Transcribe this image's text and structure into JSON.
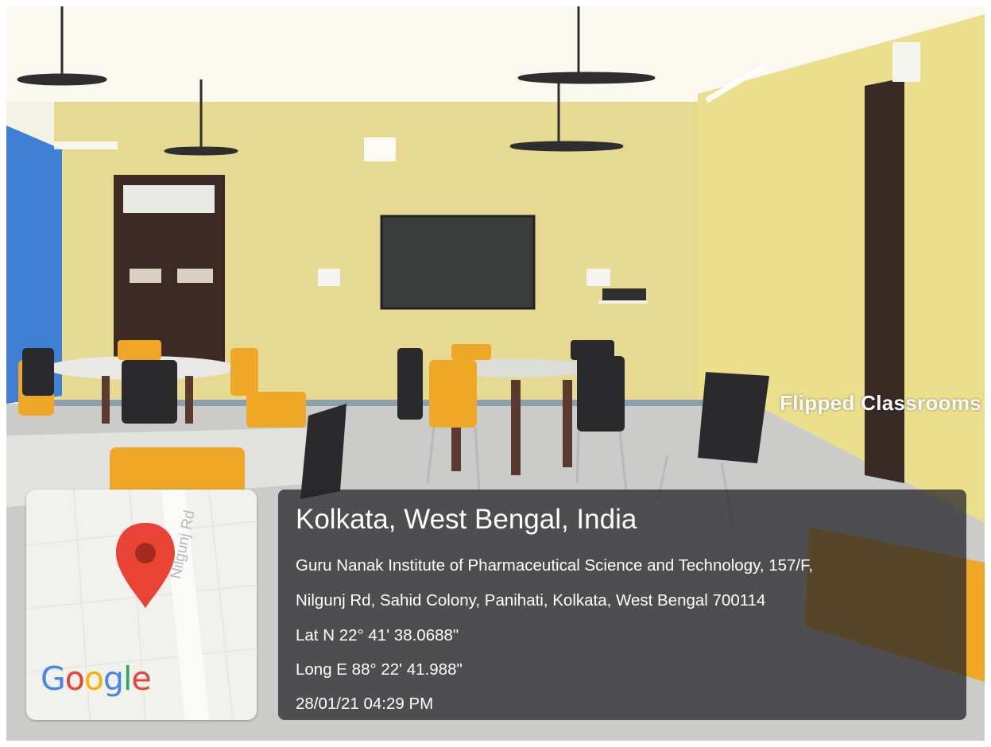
{
  "photo": {
    "caption": "Flipped Classrooms",
    "colors": {
      "wall": "#e8dc8e",
      "accent_wall": "#3b7ad0",
      "floor": "#c8c8c6",
      "chair": "#f0a92a",
      "door": "#3d2a25"
    }
  },
  "map_card": {
    "road_label": "Nilgunj Rd",
    "logo": {
      "g1": "G",
      "o1": "o",
      "o2": "o",
      "g2": "g",
      "l": "l",
      "e": "e"
    },
    "pin_color": "#e84335",
    "icon": "map-pin-icon"
  },
  "location": {
    "city": "Kolkata, West Bengal, India",
    "address_line1": "Guru Nanak Institute of Pharmaceutical Science and Technology, 157/F,",
    "address_line2": "Nilgunj Rd, Sahid Colony, Panihati, Kolkata, West Bengal 700114",
    "latitude": "Lat N 22° 41' 38.0688\"",
    "longitude": "Long E 88° 22' 41.988\"",
    "timestamp": "28/01/21 04:29 PM"
  }
}
